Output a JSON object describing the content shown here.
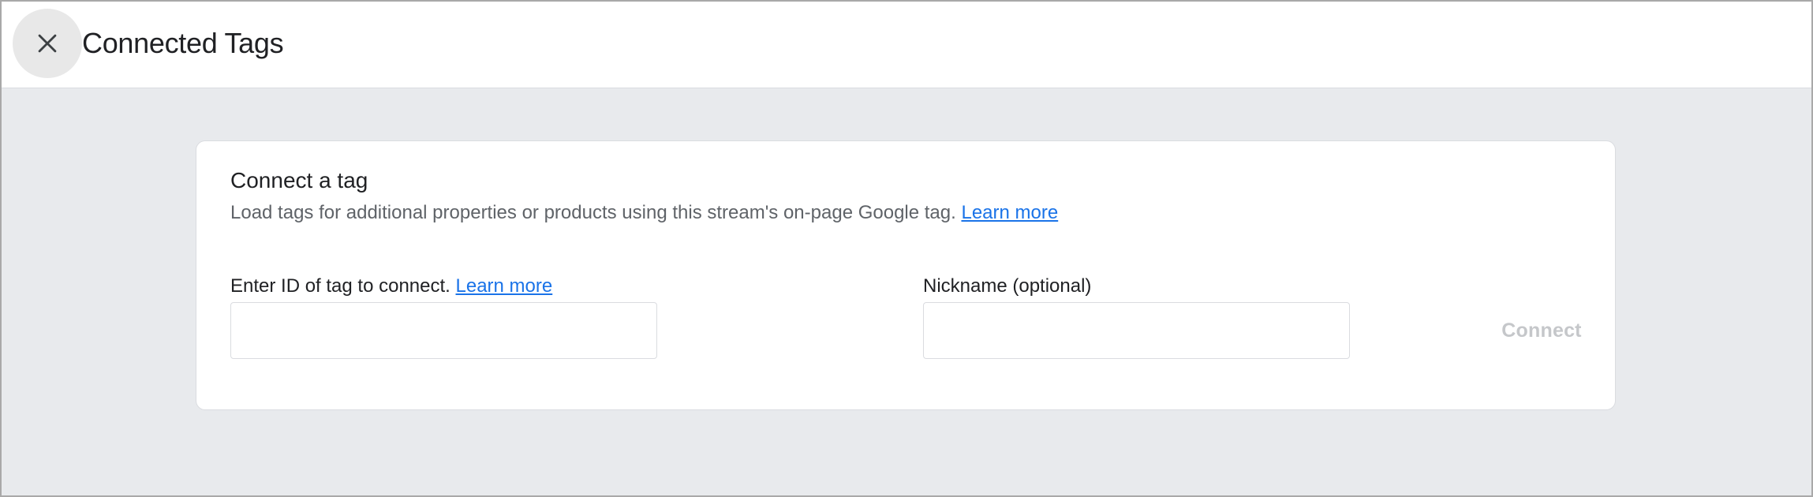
{
  "header": {
    "title": "Connected Tags",
    "close_icon": "close-icon"
  },
  "card": {
    "title": "Connect a tag",
    "description": "Load tags for additional properties or products using this stream's on-page Google tag.",
    "description_link": "Learn more",
    "tag_id_field": {
      "label": "Enter ID of tag to connect.",
      "link": "Learn more",
      "value": "",
      "placeholder": ""
    },
    "nickname_field": {
      "label": "Nickname (optional)",
      "value": "",
      "placeholder": ""
    },
    "connect_button": {
      "label": "Connect",
      "disabled": true
    }
  },
  "colors": {
    "background": "#e8eaed",
    "surface": "#ffffff",
    "link": "#1a73e8",
    "text_primary": "#202124",
    "text_secondary": "#5f6368",
    "disabled_text": "#c5c7ca"
  }
}
